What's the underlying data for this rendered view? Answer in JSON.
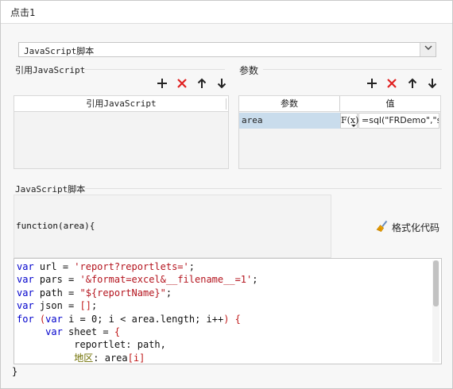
{
  "window": {
    "title": "点击1"
  },
  "script_type": {
    "selected": "JavaScript脚本"
  },
  "ref_js": {
    "section_label": "引用JavaScript",
    "column_header": "引用JavaScript"
  },
  "params": {
    "section_label": "参数",
    "col_name": "参数",
    "col_value": "值",
    "rows": [
      {
        "name": "area",
        "fx_label": "F(x)",
        "value": "=sql(\"FRDemo\",\"s"
      }
    ]
  },
  "toolbar": {
    "add_icon": "plus-icon",
    "delete_icon": "x-icon",
    "up_icon": "arrow-up-icon",
    "down_icon": "arrow-down-icon"
  },
  "script": {
    "section_label": "JavaScript脚本",
    "function_signature": "function(area){",
    "format_button_label": "格式化代码",
    "closing_brace": "}",
    "code_lines": [
      [
        {
          "t": "kw",
          "v": "var"
        },
        {
          "t": "id",
          "v": " url "
        },
        {
          "t": "op",
          "v": "= "
        },
        {
          "t": "str",
          "v": "'report?reportlets='"
        },
        {
          "t": "op",
          "v": ";"
        }
      ],
      [
        {
          "t": "kw",
          "v": "var"
        },
        {
          "t": "id",
          "v": " pars "
        },
        {
          "t": "op",
          "v": "= "
        },
        {
          "t": "str",
          "v": "'&format=excel&__filename__=1'"
        },
        {
          "t": "op",
          "v": ";"
        }
      ],
      [
        {
          "t": "kw",
          "v": "var"
        },
        {
          "t": "id",
          "v": " path "
        },
        {
          "t": "op",
          "v": "= "
        },
        {
          "t": "str",
          "v": "\"${reportName}\""
        },
        {
          "t": "op",
          "v": ";"
        }
      ],
      [
        {
          "t": "kw",
          "v": "var"
        },
        {
          "t": "id",
          "v": " json "
        },
        {
          "t": "op",
          "v": "= "
        },
        {
          "t": "punc",
          "v": "[]"
        },
        {
          "t": "op",
          "v": ";"
        }
      ],
      [
        {
          "t": "kw",
          "v": "for"
        },
        {
          "t": "id",
          "v": " "
        },
        {
          "t": "punc",
          "v": "("
        },
        {
          "t": "kw",
          "v": "var"
        },
        {
          "t": "id",
          "v": " i "
        },
        {
          "t": "op",
          "v": "= "
        },
        {
          "t": "id",
          "v": "0"
        },
        {
          "t": "op",
          "v": "; "
        },
        {
          "t": "id",
          "v": "i "
        },
        {
          "t": "op",
          "v": "< "
        },
        {
          "t": "id",
          "v": "area.length"
        },
        {
          "t": "op",
          "v": "; "
        },
        {
          "t": "id",
          "v": "i"
        },
        {
          "t": "op",
          "v": "++"
        },
        {
          "t": "punc",
          "v": ") {"
        }
      ],
      [
        {
          "t": "id",
          "v": "     "
        },
        {
          "t": "kw",
          "v": "var"
        },
        {
          "t": "id",
          "v": " sheet "
        },
        {
          "t": "op",
          "v": "= "
        },
        {
          "t": "punc",
          "v": "{"
        }
      ],
      [
        {
          "t": "id",
          "v": "          reportlet"
        },
        {
          "t": "op",
          "v": ": "
        },
        {
          "t": "id",
          "v": "path,"
        }
      ],
      [
        {
          "t": "id",
          "v": "          "
        },
        {
          "t": "zh",
          "v": "地区"
        },
        {
          "t": "op",
          "v": ": "
        },
        {
          "t": "id",
          "v": "area"
        },
        {
          "t": "punc",
          "v": "[i]"
        }
      ],
      [
        {
          "t": "id",
          "v": "     "
        },
        {
          "t": "punc",
          "v": "};"
        }
      ]
    ]
  }
}
